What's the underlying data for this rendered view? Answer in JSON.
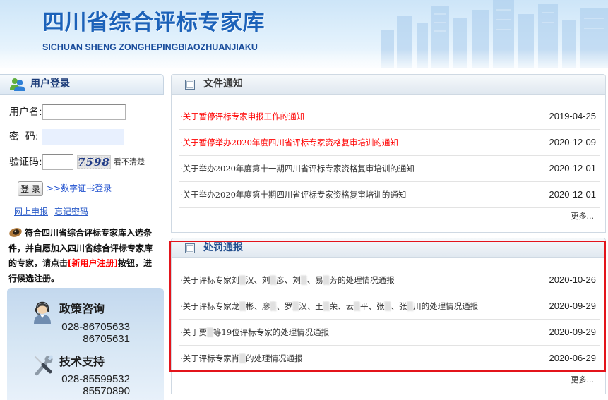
{
  "header": {
    "title": "四川省综合评标专家库",
    "subtitle": "SICHUAN SHENG ZONGHEPINGBIAOZHUANJIAKU"
  },
  "colors": {
    "title_blue": "#1c62b9",
    "link_blue": "#1e4fcf",
    "alert_red": "#ff0000",
    "text_dark": "#333333",
    "annotation_red": "#e3141b"
  },
  "login": {
    "panel_icon": "user-group-icon",
    "panel_title": "用户登录",
    "username_label": "用户名:",
    "username_value": "",
    "password_label": "密  码:",
    "password_value": "",
    "captcha_label": "验证码:",
    "captcha_value": "",
    "captcha_code": "7598",
    "captcha_refresh": "看不清楚",
    "login_button": "登 录",
    "cert_login_link": ">>数字证书登录",
    "online_apply_link": "网上申报",
    "forgot_password_link": "忘记密码",
    "notice_icon": "notice-icon",
    "notice_text_before": "符合四川省综合评标专家库入选条件，并自愿加入四川省综合评标专家库的专家，请点击",
    "notice_register_link": "[新用户注册]",
    "notice_text_after": "按钮，进行候选注册。"
  },
  "contact": [
    {
      "icon": "customer-service-icon",
      "title": "政策咨询",
      "phones": [
        "028-86705633",
        "86705631"
      ]
    },
    {
      "icon": "tools-icon",
      "title": "技术支持",
      "phones": [
        "028-85599532",
        "85570890"
      ]
    }
  ],
  "panels": [
    {
      "icon": "panel-square-icon",
      "title": "文件通知",
      "title_color": "#333333",
      "more": "更多...",
      "items": [
        {
          "title": "·关于暂停评标专家申报工作的通知",
          "date": "2019-04-25",
          "color": "#ff0000"
        },
        {
          "title": "·关于暂停举办2020年度四川省评标专家资格复审培训的通知",
          "date": "2020-12-09",
          "color": "#ff0000"
        },
        {
          "title": "·关于举办2020年度第十一期四川省评标专家资格复审培训的通知",
          "date": "2020-12-01",
          "color": "#333333"
        },
        {
          "title": "·关于举办2020年度第十期四川省评标专家资格复审培训的通知",
          "date": "2020-12-01",
          "color": "#333333"
        }
      ]
    },
    {
      "icon": "panel-square-icon",
      "title": "处罚通报",
      "title_color": "#234f8f",
      "more": "更多...",
      "items": [
        {
          "title": "·关于评标专家刘▒汉、刘▒彦、刘▒、易▒芳的处理情况通报",
          "date": "2020-10-26",
          "color": "#333333"
        },
        {
          "title": "·关于评标专家龙▒彬、廖▒、罗▒汉、王▒荣、云▒平、张▒、张▒川的处理情况通报",
          "date": "2020-09-29",
          "color": "#333333"
        },
        {
          "title": "·关于贾▒等19位评标专家的处理情况通报",
          "date": "2020-09-29",
          "color": "#333333"
        },
        {
          "title": "·关于评标专家肖▒的处理情况通报",
          "date": "2020-06-29",
          "color": "#333333"
        }
      ]
    }
  ]
}
